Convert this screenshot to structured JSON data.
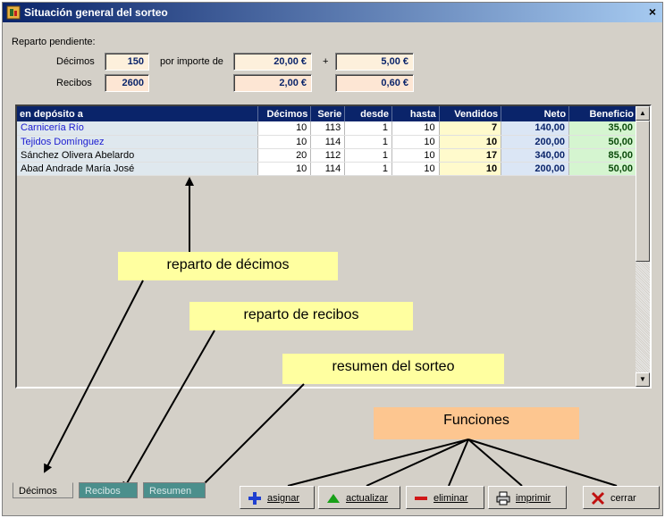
{
  "window": {
    "title": "Situación general del sorteo",
    "close_label": "×"
  },
  "reparto": {
    "heading": "Reparto pendiente:",
    "decimos_label": "Décimos",
    "decimos_value": "150",
    "por_importe_label": "por importe de",
    "decimos_importe": "20,00 €",
    "plus_label": "+",
    "decimos_extra": "5,00 €",
    "recibos_label": "Recibos",
    "recibos_value": "2600",
    "recibos_importe": "2,00 €",
    "recibos_extra": "0,60 €"
  },
  "grid": {
    "columns": [
      "en depósito a",
      "Décimos",
      "Serie",
      "desde",
      "hasta",
      "Vendidos",
      "Neto",
      "Beneficio"
    ],
    "rows": [
      {
        "name": "Carnicería Río",
        "decimos": "10",
        "serie": "113",
        "desde": "1",
        "hasta": "10",
        "vendidos": "7",
        "neto": "140,00",
        "beneficio": "35,00"
      },
      {
        "name": "Tejidos Domínguez",
        "decimos": "10",
        "serie": "114",
        "desde": "1",
        "hasta": "10",
        "vendidos": "10",
        "neto": "200,00",
        "beneficio": "50,00"
      },
      {
        "name": "Sánchez Olivera Abelardo",
        "decimos": "20",
        "serie": "112",
        "desde": "1",
        "hasta": "10",
        "vendidos": "17",
        "neto": "340,00",
        "beneficio": "85,00"
      },
      {
        "name": "Abad Andrade María José",
        "decimos": "10",
        "serie": "114",
        "desde": "1",
        "hasta": "10",
        "vendidos": "10",
        "neto": "200,00",
        "beneficio": "50,00"
      }
    ]
  },
  "callouts": {
    "decimos": "reparto de décimos",
    "recibos": "reparto de recibos",
    "resumen": "resumen del sorteo",
    "funciones": "Funciones"
  },
  "tabs": [
    "Décimos",
    "Recibos",
    "Resumen"
  ],
  "buttons": {
    "asignar": "asignar",
    "actualizar": "actualizar",
    "eliminar": "eliminar",
    "imprimir": "imprimir",
    "cerrar": "cerrar"
  },
  "colors": {
    "title_start": "#0a246a",
    "callout_yellow": "#ffffa0",
    "callout_orange": "#fdc690",
    "tab_inactive": "#4b8f8c"
  }
}
